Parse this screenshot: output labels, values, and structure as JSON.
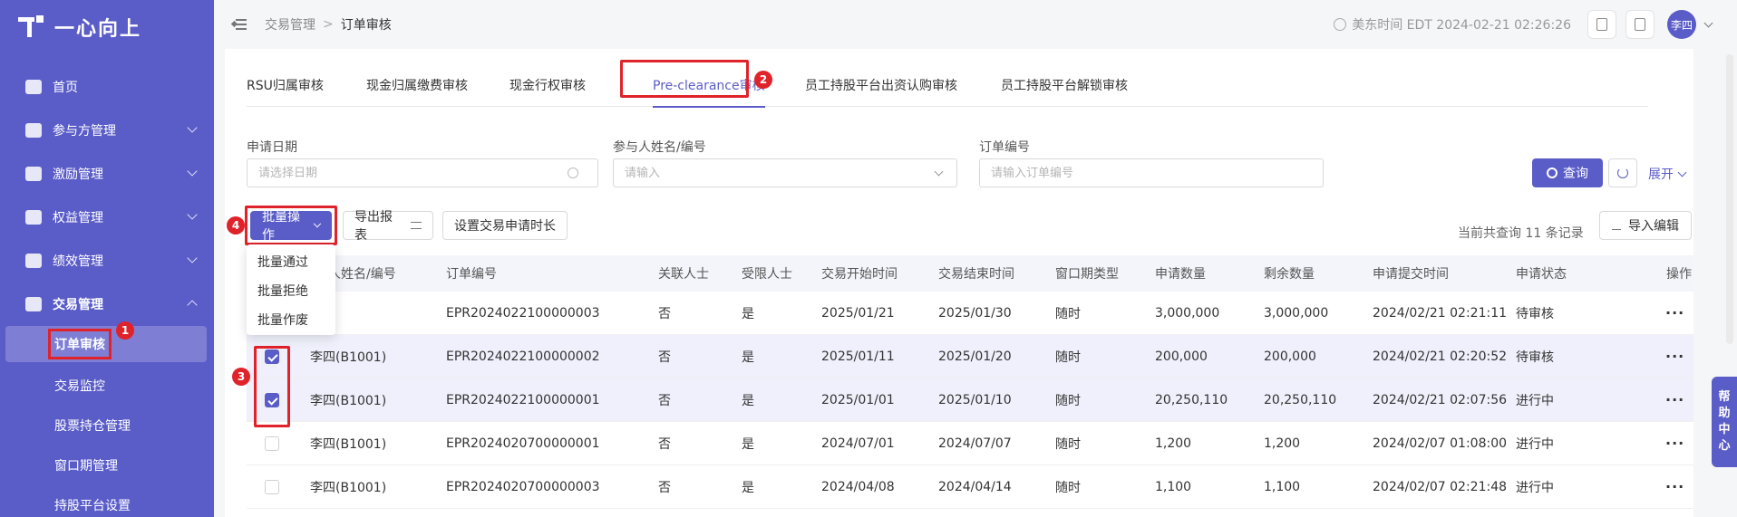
{
  "app": {
    "brand": "一心向上"
  },
  "sidebar": {
    "items": [
      {
        "label": "首页"
      },
      {
        "label": "参与方管理"
      },
      {
        "label": "激励管理"
      },
      {
        "label": "权益管理"
      },
      {
        "label": "绩效管理"
      },
      {
        "label": "交易管理"
      }
    ],
    "sub_items": [
      {
        "label": "订单审核"
      },
      {
        "label": "交易监控"
      },
      {
        "label": "股票持仓管理"
      },
      {
        "label": "窗口期管理"
      },
      {
        "label": "持股平台设置"
      }
    ]
  },
  "header": {
    "breadcrumb": [
      "交易管理",
      "订单审核"
    ],
    "breadcrumb_sep": ">",
    "time": "美东时间 EDT 2024-02-21 02:26:26",
    "user": "李四"
  },
  "tabs": [
    {
      "label": "RSU归属审核"
    },
    {
      "label": "现金归属缴费审核"
    },
    {
      "label": "现金行权审核"
    },
    {
      "label": "Pre-clearance审核"
    },
    {
      "label": "员工持股平台出资认购审核"
    },
    {
      "label": "员工持股平台解锁审核"
    }
  ],
  "filters": {
    "date_label": "申请日期",
    "date_placeholder": "请选择日期",
    "participant_label": "参与人姓名/编号",
    "participant_placeholder": "请输入",
    "order_label": "订单编号",
    "order_placeholder": "请输入订单编号",
    "query_btn": "查询",
    "expand": "展开"
  },
  "toolbar": {
    "batch": "批量操作",
    "export": "导出报表",
    "set_duration": "设置交易申请时长",
    "record_info": "当前共查询 11 条记录",
    "import_edit": "导入编辑"
  },
  "batch_menu": [
    "批量通过",
    "批量拒绝",
    "批量作废"
  ],
  "table": {
    "columns": [
      "参与人姓名/编号",
      "订单编号",
      "关联人士",
      "受限人士",
      "交易开始时间",
      "交易结束时间",
      "窗口期类型",
      "申请数量",
      "剩余数量",
      "申请提交时间",
      "申请状态",
      "操作"
    ],
    "column_partial": "人姓名/编号",
    "rows": [
      {
        "name": "",
        "order": "EPR2024022100000003",
        "related": "否",
        "restricted": "是",
        "start": "2025/01/21",
        "end": "2025/01/30",
        "window": "随时",
        "qty": "3,000,000",
        "remain": "3,000,000",
        "submit": "2024/02/21 02:21:11",
        "status": "待审核",
        "checked": false,
        "hidden_cb": true
      },
      {
        "name": "李四(B1001)",
        "order": "EPR2024022100000002",
        "related": "否",
        "restricted": "是",
        "start": "2025/01/11",
        "end": "2025/01/20",
        "window": "随时",
        "qty": "200,000",
        "remain": "200,000",
        "submit": "2024/02/21 02:20:52",
        "status": "待审核",
        "checked": true
      },
      {
        "name": "李四(B1001)",
        "order": "EPR2024022100000001",
        "related": "否",
        "restricted": "是",
        "start": "2025/01/01",
        "end": "2025/01/10",
        "window": "随时",
        "qty": "20,250,110",
        "remain": "20,250,110",
        "submit": "2024/02/21 02:07:56",
        "status": "进行中",
        "checked": true
      },
      {
        "name": "李四(B1001)",
        "order": "EPR2024020700000001",
        "related": "否",
        "restricted": "是",
        "start": "2024/07/01",
        "end": "2024/07/07",
        "window": "随时",
        "qty": "1,200",
        "remain": "1,200",
        "submit": "2024/02/07 01:08:00",
        "status": "进行中",
        "checked": false
      },
      {
        "name": "李四(B1001)",
        "order": "EPR2024020700000003",
        "related": "否",
        "restricted": "是",
        "start": "2024/04/08",
        "end": "2024/04/14",
        "window": "随时",
        "qty": "1,100",
        "remain": "1,100",
        "submit": "2024/02/07 02:21:48",
        "status": "进行中",
        "checked": false
      }
    ],
    "more": "···"
  },
  "help": [
    "帮",
    "助",
    "中",
    "心"
  ],
  "annotations": [
    "1",
    "2",
    "3",
    "4"
  ],
  "colors": {
    "accent": "#5a5cc8",
    "highlight": "#e0222a"
  }
}
